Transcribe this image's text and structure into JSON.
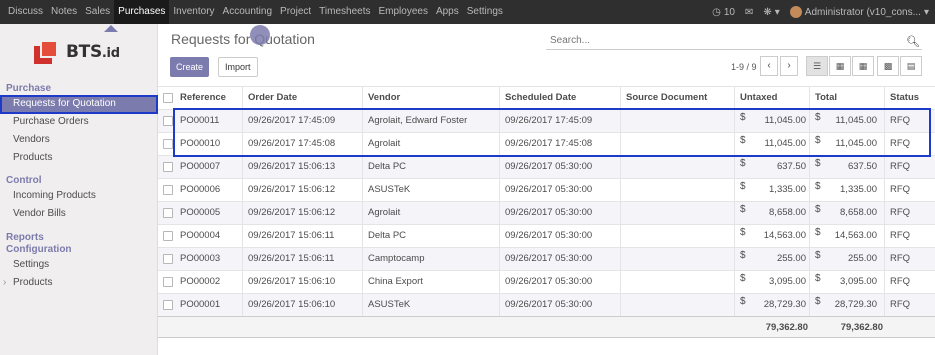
{
  "topnav": {
    "items": [
      "Discuss",
      "Notes",
      "Sales",
      "Purchases",
      "Inventory",
      "Accounting",
      "Project",
      "Timesheets",
      "Employees",
      "Apps",
      "Settings"
    ],
    "active": "Purchases",
    "activity_count": "10",
    "activity_icon": "clock-icon",
    "user": "Administrator (v10_cons..."
  },
  "brand": {
    "name": "BTS",
    "suffix": ".id"
  },
  "sidebar": {
    "sections": [
      {
        "title": "Purchase",
        "items": [
          "Requests for Quotation",
          "Purchase Orders",
          "Vendors",
          "Products"
        ]
      },
      {
        "title": "Control",
        "items": [
          "Incoming Products",
          "Vendor Bills"
        ]
      },
      {
        "title": "Reports",
        "items": []
      },
      {
        "title": "Configuration",
        "items": [
          "Settings",
          "Products"
        ]
      }
    ],
    "active_item": "Requests for Quotation"
  },
  "page": {
    "title": "Requests for Quotation",
    "create_label": "Create",
    "import_label": "Import",
    "search_placeholder": "Search...",
    "pager": "1-9 / 9"
  },
  "table": {
    "columns": [
      "Reference",
      "Order Date",
      "Vendor",
      "Scheduled Date",
      "Source Document",
      "Untaxed",
      "Total",
      "Status"
    ],
    "currency": "$",
    "rows": [
      [
        "PO00011",
        "09/26/2017 17:45:09",
        "Agrolait, Edward Foster",
        "09/26/2017 17:45:09",
        "",
        "11,045.00",
        "11,045.00",
        "RFQ"
      ],
      [
        "PO00010",
        "09/26/2017 17:45:08",
        "Agrolait",
        "09/26/2017 17:45:08",
        "",
        "11,045.00",
        "11,045.00",
        "RFQ"
      ],
      [
        "PO00007",
        "09/26/2017 15:06:13",
        "Delta PC",
        "09/26/2017 05:30:00",
        "",
        "637.50",
        "637.50",
        "RFQ"
      ],
      [
        "PO00006",
        "09/26/2017 15:06:12",
        "ASUSTeK",
        "09/26/2017 05:30:00",
        "",
        "1,335.00",
        "1,335.00",
        "RFQ"
      ],
      [
        "PO00005",
        "09/26/2017 15:06:12",
        "Agrolait",
        "09/26/2017 05:30:00",
        "",
        "8,658.00",
        "8,658.00",
        "RFQ"
      ],
      [
        "PO00004",
        "09/26/2017 15:06:11",
        "Delta PC",
        "09/26/2017 05:30:00",
        "",
        "14,563.00",
        "14,563.00",
        "RFQ"
      ],
      [
        "PO00003",
        "09/26/2017 15:06:11",
        "Camptocamp",
        "09/26/2017 05:30:00",
        "",
        "255.00",
        "255.00",
        "RFQ"
      ],
      [
        "PO00002",
        "09/26/2017 15:06:10",
        "China Export",
        "09/26/2017 05:30:00",
        "",
        "3,095.00",
        "3,095.00",
        "RFQ"
      ],
      [
        "PO00001",
        "09/26/2017 15:06:10",
        "ASUSTeK",
        "09/26/2017 05:30:00",
        "",
        "28,729.30",
        "28,729.30",
        "RFQ"
      ]
    ],
    "totals": {
      "untaxed": "79,362.80",
      "total": "79,362.80"
    }
  },
  "colors": {
    "accent": "#7c7bad",
    "highlight_frame": "#1d3bc8",
    "topbar": "#2f2f2f"
  }
}
